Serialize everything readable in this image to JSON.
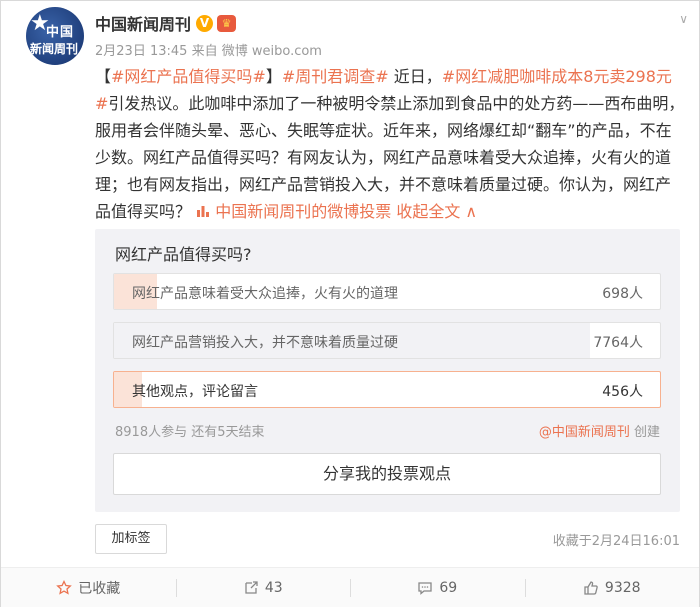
{
  "post": {
    "avatar": {
      "line1": "中国",
      "line2": "新闻周刊"
    },
    "author": "中国新闻周刊",
    "time": "2月23日 13:45",
    "source_prefix": "来自",
    "source": "微博 weibo.com",
    "text": {
      "bracket_open": "【",
      "tag1": "#网红产品值得买吗#",
      "bracket_close": "】",
      "tag2": "#周刊君调查#",
      "t1": " 近日，",
      "tag3": "#网红减肥咖啡成本8元卖298元#",
      "t2": "引发热议。此咖啡中添加了一种被明令禁止添加到食品中的处方药——西布曲明，服用者会伴随头晕、恶心、失眠等症状。近年来，网络爆红却“翻车”的产品，不在少数。网红产品值得买吗？有网友认为，网红产品意味着受大众追捧，火有火的道理；也有网友指出，网红产品营销投入大，并不意味着质量过硬。你认为，网红产品值得买吗？",
      "poll_link": "中国新闻周刊的微博投票",
      "collapse": "收起全文"
    }
  },
  "poll": {
    "question": "网红产品值得买吗?",
    "options": [
      {
        "label": "网红产品意味着受大众追捧，火有火的道理",
        "count": "698人",
        "share": 0.078
      },
      {
        "label": "网红产品营销投入大，并不意味着质量过硬",
        "count": "7764人",
        "share": 0.871
      },
      {
        "label": "其他观点，评论留言",
        "count": "456人",
        "share": 0.051
      }
    ],
    "stats": "8918人参与 还有5天结束",
    "creator": "@中国新闻周刊",
    "creator_suffix": "创建",
    "share_button": "分享我的投票观点"
  },
  "add_tag": "加标签",
  "fav_time": "收藏于2月24日16:01",
  "footer": {
    "favorite": "已收藏",
    "repost": "43",
    "comment": "69",
    "like": "9328"
  },
  "colors": {
    "accent": "#eb7350",
    "vote_fill": "#fbe3d8",
    "badge": "#ffaa00"
  }
}
